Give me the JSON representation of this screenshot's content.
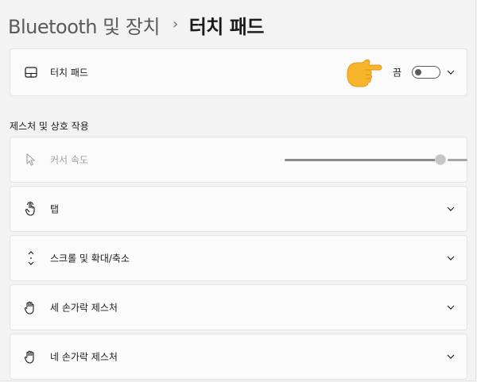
{
  "breadcrumb": {
    "parent": "Bluetooth 및 장치",
    "separator": "›",
    "current": "터치 패드"
  },
  "touchpad_card": {
    "label": "터치 패드",
    "toggle_state_label": "끔",
    "toggle_on": false,
    "icon": "touchpad-icon",
    "pointer": "pointing-hand-emoji"
  },
  "section": {
    "title": "제스처 및 상호 작용"
  },
  "cursor_speed": {
    "label": "커서 속도",
    "icon": "cursor-icon",
    "value_fraction": 0.86,
    "disabled": true
  },
  "rows": [
    {
      "label": "탭",
      "icon": "tap-hand-icon"
    },
    {
      "label": "스크롤 및 확대/축소",
      "icon": "scroll-arrows-icon"
    },
    {
      "label": "세 손가락 제스처",
      "icon": "three-finger-hand-icon"
    },
    {
      "label": "네 손가락 제스처",
      "icon": "four-finger-hand-icon"
    }
  ],
  "colors": {
    "page_bg": "#f3f3f3",
    "card_bg": "#fbfbfb",
    "toggle_off": "#5c5c5c",
    "emoji_hand": "#f7b52c"
  }
}
